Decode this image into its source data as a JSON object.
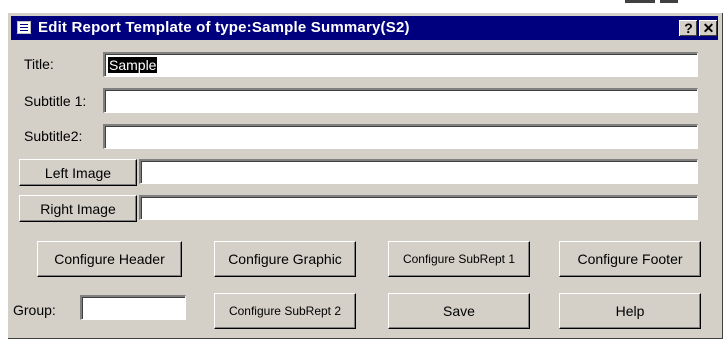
{
  "window": {
    "title": "Edit Report Template of type:Sample Summary(S2)",
    "help_glyph": "?",
    "close_glyph": "✕"
  },
  "form": {
    "title_label": "Title:",
    "title_value": "Sample",
    "subtitle1_label": "Subtitle 1:",
    "subtitle1_value": "",
    "subtitle2_label": "Subtitle2:",
    "subtitle2_value": "",
    "left_image_button": "Left Image",
    "left_image_value": "",
    "right_image_button": "Right Image",
    "right_image_value": "",
    "group_label": "Group:",
    "group_value": ""
  },
  "buttons": {
    "configure_header": "Configure Header",
    "configure_graphic": "Configure Graphic",
    "configure_subrept1": "Configure SubRept 1",
    "configure_footer": "Configure Footer",
    "configure_subrept2": "Configure SubRept 2",
    "save": "Save",
    "help": "Help"
  },
  "colors": {
    "titlebar": "#00007f",
    "dialog_face": "#d4d0c8"
  }
}
